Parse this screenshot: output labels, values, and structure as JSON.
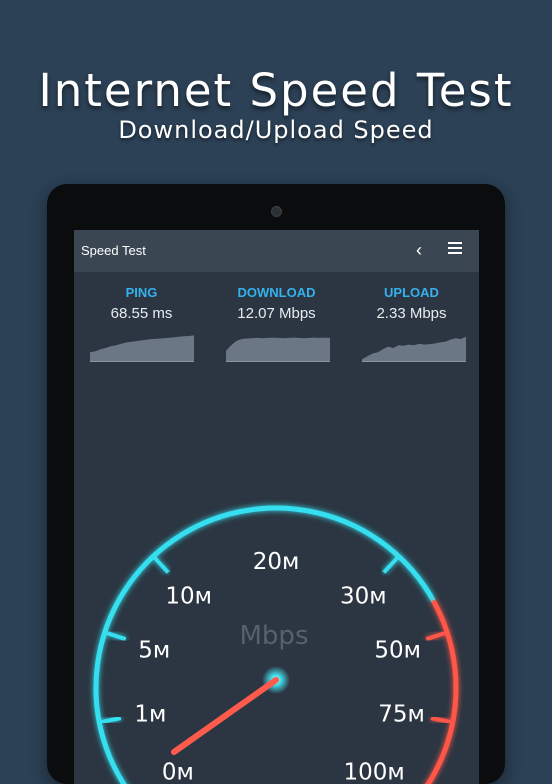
{
  "promo": {
    "headline": "Internet Speed Test",
    "subheadline": "Download/Upload Speed"
  },
  "appbar": {
    "title": "Speed Test",
    "back_icon": "chevron-left-icon",
    "menu_icon": "hamburger-menu-icon"
  },
  "stats": {
    "ping": {
      "label": "PING",
      "value": "68.55 ms",
      "sparkline": [
        0.35,
        0.38,
        0.45,
        0.5,
        0.56,
        0.6,
        0.65,
        0.7,
        0.72,
        0.75,
        0.78,
        0.8,
        0.82,
        0.83,
        0.85,
        0.86,
        0.88,
        0.9,
        0.92,
        0.93,
        0.95
      ]
    },
    "download": {
      "label": "DOWNLOAD",
      "value": "12.07 Mbps",
      "sparkline": [
        0.4,
        0.6,
        0.75,
        0.82,
        0.84,
        0.85,
        0.86,
        0.85,
        0.86,
        0.87,
        0.86,
        0.85,
        0.86,
        0.87,
        0.86,
        0.85,
        0.86,
        0.87,
        0.86,
        0.87,
        0.86
      ]
    },
    "upload": {
      "label": "UPLOAD",
      "value": "2.33 Mbps",
      "sparkline": [
        0.1,
        0.2,
        0.3,
        0.35,
        0.45,
        0.55,
        0.5,
        0.6,
        0.58,
        0.62,
        0.6,
        0.65,
        0.62,
        0.64,
        0.66,
        0.7,
        0.72,
        0.8,
        0.85,
        0.82,
        0.9
      ]
    }
  },
  "gauge": {
    "unit": "Mbps",
    "ticks": [
      "0м",
      "1м",
      "5м",
      "10м",
      "20м",
      "30м",
      "50м",
      "75м",
      "100м"
    ],
    "needle_value": "1м",
    "colors": {
      "normal_arc": "#35dff0",
      "high_arc": "#ff5648",
      "needle": "#ff5b4d",
      "hub_glow": "#46f0ff",
      "sparkline": "#6b7784"
    }
  }
}
